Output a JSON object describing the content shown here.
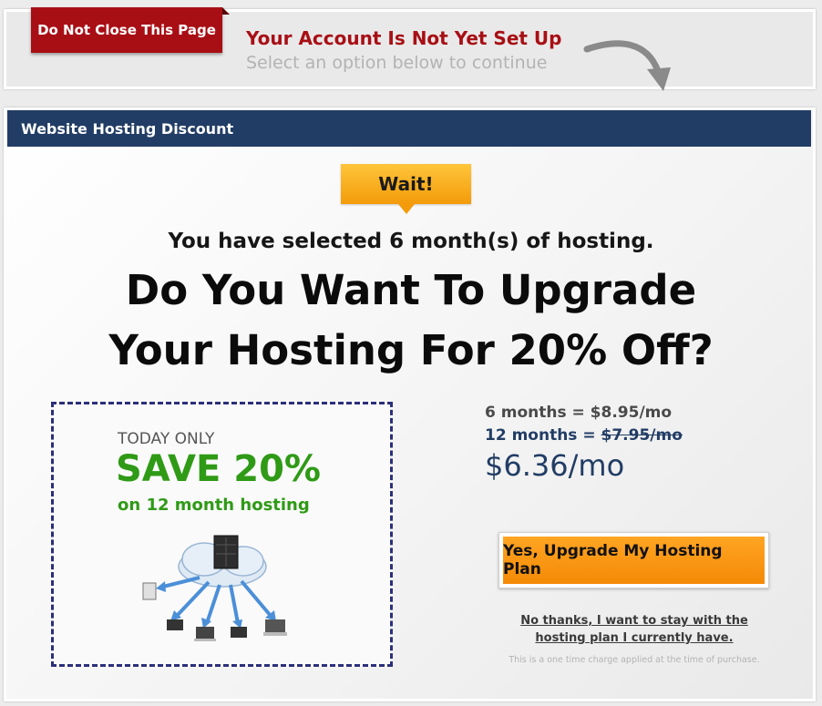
{
  "notice": {
    "ribbon_label": "Do Not Close This Page",
    "title": "Your Account Is Not Yet Set Up",
    "subtitle": "Select an option below to continue"
  },
  "offer": {
    "header": "Website Hosting Discount",
    "wait_label": "Wait!",
    "selected_text": "You have selected 6 month(s) of hosting.",
    "headline_line1": "Do You Want To Upgrade",
    "headline_line2": "Your Hosting For 20% Off?"
  },
  "coupon": {
    "today_only": "TODAY ONLY",
    "save": "SAVE 20%",
    "subtext": "on 12 month hosting"
  },
  "pricing": {
    "six_months_label": "6 months = ",
    "six_months_price": "$8.95/mo",
    "twelve_months_label": "12 months = ",
    "twelve_months_old_price": "$7.95/mo",
    "new_price": "$6.36/mo"
  },
  "actions": {
    "upgrade_label": "Yes, Upgrade My Hosting Plan",
    "decline_label": "No thanks, I want to stay with the hosting plan I currently have.",
    "fine_print": "This is a one time charge applied at the time of purchase."
  },
  "colors": {
    "brand_red": "#a80f15",
    "header_navy": "#223d65",
    "accent_orange": "#f48a06",
    "save_green": "#2f9a16",
    "coupon_border": "#2b2f7a"
  },
  "icons": [
    "curved-arrow-icon",
    "server-cloud-network-icon"
  ]
}
